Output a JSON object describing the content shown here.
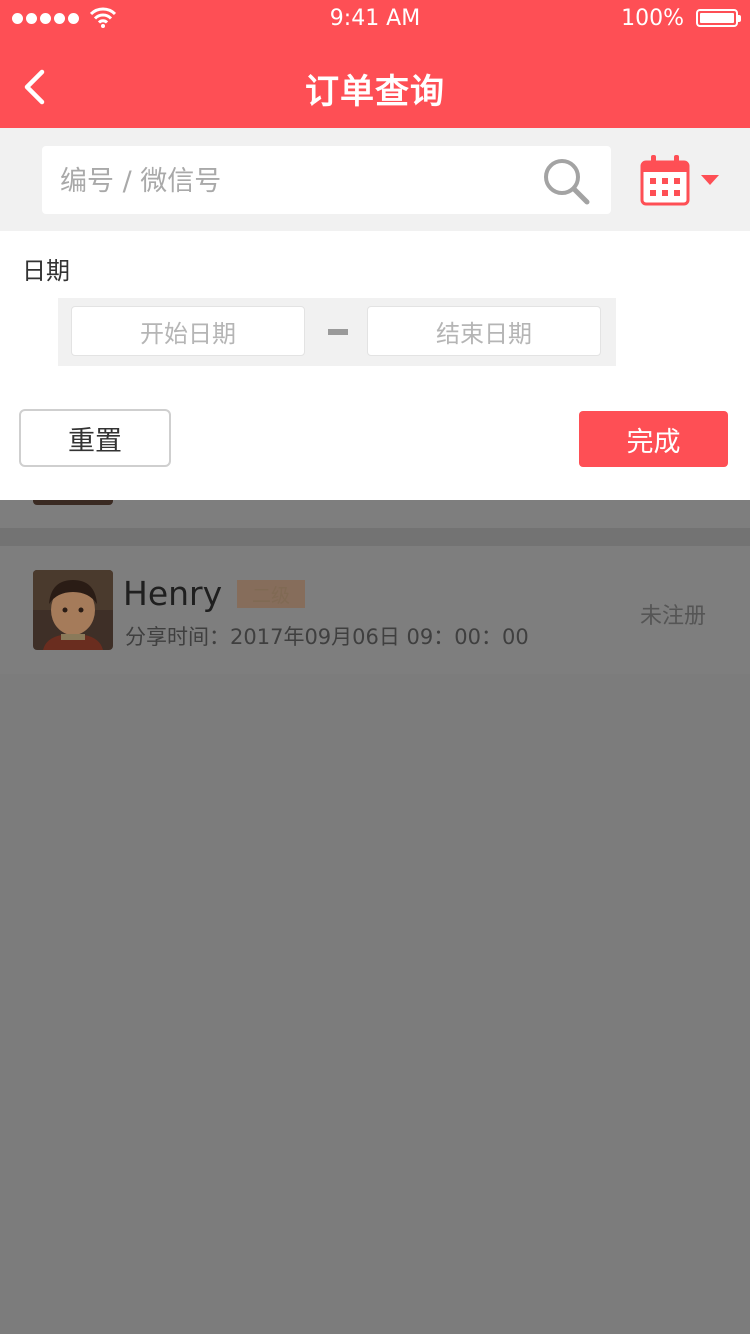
{
  "status_bar": {
    "time": "9:41 AM",
    "battery": "100%"
  },
  "header": {
    "title": "订单查询"
  },
  "search": {
    "placeholder": "编号 / 微信号"
  },
  "filter": {
    "label": "日期",
    "start_placeholder": "开始日期",
    "end_placeholder": "结束日期",
    "reset_label": "重置",
    "done_label": "完成"
  },
  "list": {
    "items": [
      {
        "name": "Henry",
        "level": "二级",
        "share_time": "分享时间：2017年09月06日  09：00：00",
        "status": "未注册"
      }
    ]
  },
  "colors": {
    "accent": "#fe4f55",
    "overlay": "#7c7c7c"
  }
}
